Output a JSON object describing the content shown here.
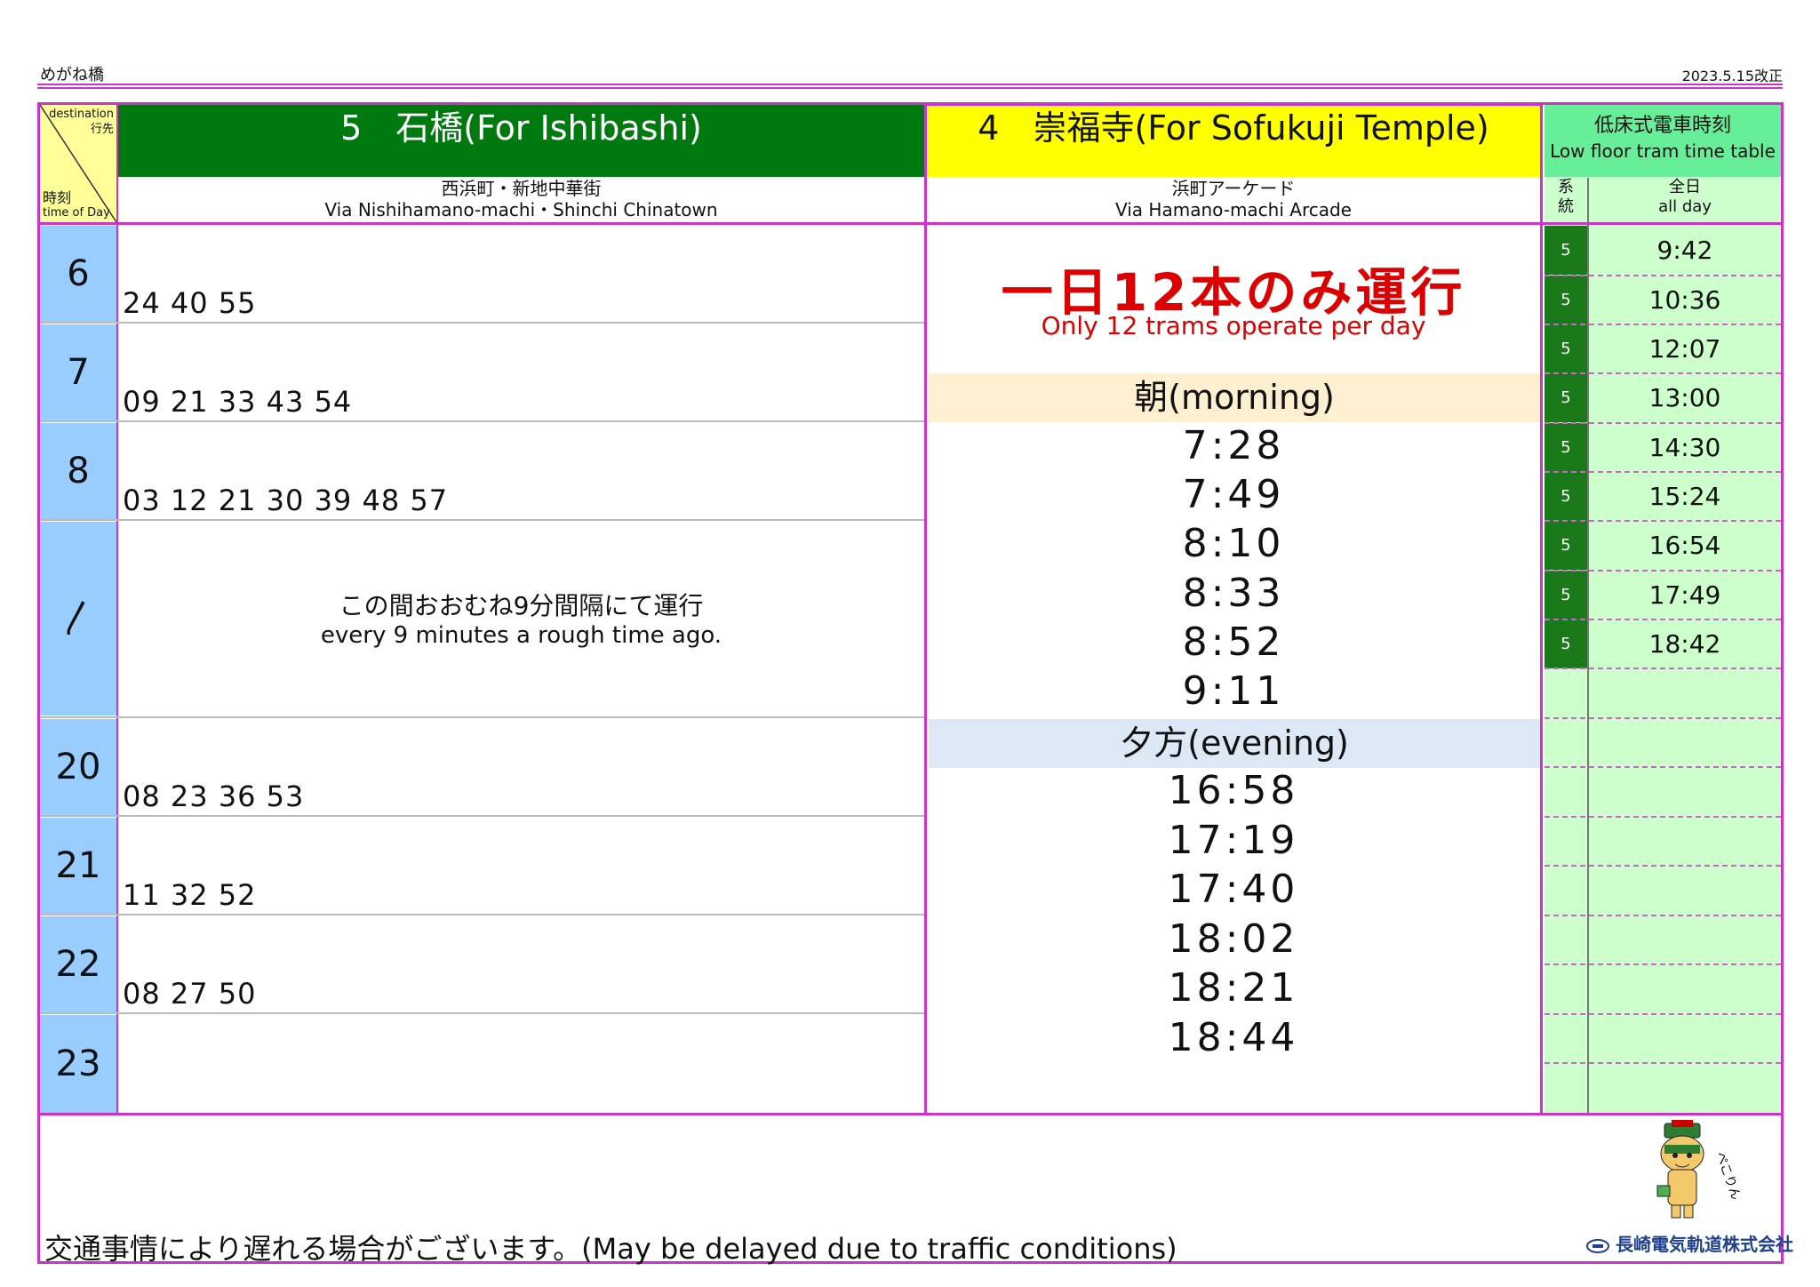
{
  "page": {
    "station": "めがね橋",
    "revision": "2023.5.15改正"
  },
  "header": {
    "corner_dest": "destination\n行先",
    "corner_dest_1": "destination",
    "corner_dest_2": "行先",
    "corner_time_1": "時刻",
    "corner_time_2": "time of Day",
    "ishibashi_title": "5　石橋(For Ishibashi)",
    "ishibashi_via_jp": "西浜町・新地中華街",
    "ishibashi_via_en": "Via Nishihamano-machi・Shinchi Chinatown",
    "sofukuji_title": "4　崇福寺(For Sofukuji Temple)",
    "sofukuji_via_jp": "浜町アーケード",
    "sofukuji_via_en": "Via Hamano-machi Arcade",
    "lowfloor_jp": "低床式電車時刻",
    "lowfloor_en": "Low floor tram time table",
    "route_label_1": "系",
    "route_label_2": "統",
    "allday_jp": "全日",
    "allday_en": "all day"
  },
  "ishibashi": {
    "rows": [
      {
        "hour": "6",
        "minutes": "24 40 55"
      },
      {
        "hour": "7",
        "minutes": "09 21 33 43 54"
      },
      {
        "hour": "8",
        "minutes": "03 12 21 30 39 48 57"
      },
      {
        "hour": "〳",
        "interval_jp": "この間おおむね9分間隔にて運行",
        "interval_en": "every 9 minutes a rough time ago."
      },
      {
        "hour": "20",
        "minutes": "08 23 36 53"
      },
      {
        "hour": "21",
        "minutes": "11 32 52"
      },
      {
        "hour": "22",
        "minutes": "08 27 50"
      },
      {
        "hour": "23",
        "minutes": ""
      }
    ]
  },
  "sofukuji": {
    "notice_jp": "一日12本のみ運行",
    "notice_en": "Only 12 trams operate per day",
    "morning_label": "朝(morning)",
    "morning_times": [
      "7:28",
      "7:49",
      "8:10",
      "8:33",
      "8:52",
      "9:11"
    ],
    "evening_label": "夕方(evening)",
    "evening_times": [
      "16:58",
      "17:19",
      "17:40",
      "18:02",
      "18:21",
      "18:44"
    ]
  },
  "lowfloor": {
    "rows": [
      {
        "route": "5",
        "time": "9:42"
      },
      {
        "route": "5",
        "time": "10:36"
      },
      {
        "route": "5",
        "time": "12:07"
      },
      {
        "route": "5",
        "time": "13:00"
      },
      {
        "route": "5",
        "time": "14:30"
      },
      {
        "route": "5",
        "time": "15:24"
      },
      {
        "route": "5",
        "time": "16:54"
      },
      {
        "route": "5",
        "time": "17:49"
      },
      {
        "route": "5",
        "time": "18:42"
      }
    ]
  },
  "footer": {
    "delay_notice": "交通事情により遅れる場合がございます。(May be delayed due to traffic conditions)",
    "company": "長崎電気軌道株式会社",
    "mascot_caption": "ぺこりん"
  },
  "colors": {
    "border": "#cc33cc",
    "ishibashi": "#007a0f",
    "sofukuji": "#ffff00",
    "lowfloor": "#66ee99",
    "hour_col": "#99ccff",
    "morning_band": "#fdefd0",
    "evening_band": "#dce9f5",
    "notice": "#dd0000"
  }
}
